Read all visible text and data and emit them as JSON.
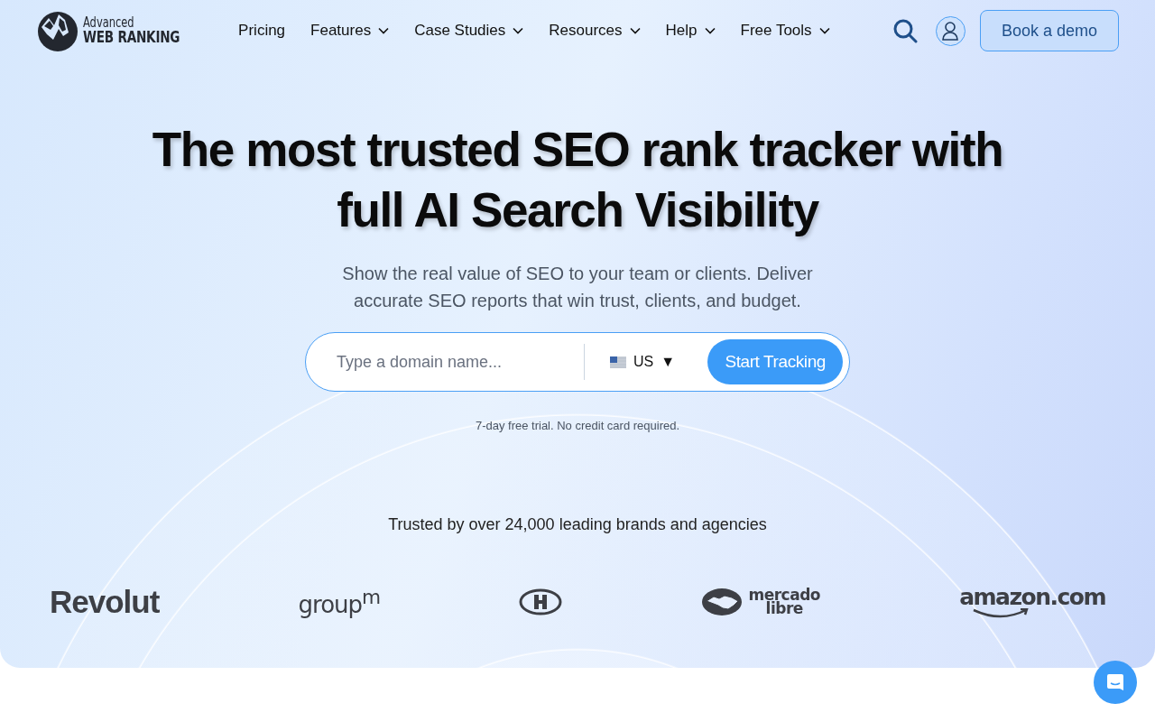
{
  "header": {
    "logo": {
      "line_1": "Advanced",
      "line_2": "WEB RANKING"
    },
    "nav": [
      {
        "label": "Pricing",
        "has_menu": false
      },
      {
        "label": "Features",
        "has_menu": true
      },
      {
        "label": "Case Studies",
        "has_menu": true
      },
      {
        "label": "Resources",
        "has_menu": true
      },
      {
        "label": "Help",
        "has_menu": true
      },
      {
        "label": "Free Tools",
        "has_menu": true
      }
    ],
    "cta": "Book a demo"
  },
  "hero": {
    "headline": "The most trusted SEO rank tracker with full AI Search Visibility",
    "subtitle": "Show the real value of SEO to your team or clients. Deliver accurate SEO reports that win trust, clients, and budget.",
    "domain_field": {
      "placeholder": "Type a domain name..."
    },
    "country": {
      "code": "US",
      "caret": "▼"
    },
    "submit": "Start Tracking",
    "note": "7-day free trial. No credit card required."
  },
  "trust": {
    "heading": "Trusted by over 24,000 leading brands and agencies",
    "logos": [
      {
        "kind": "revolut",
        "text": "Revolut"
      },
      {
        "kind": "groupm",
        "text": "group$^{m}$"
      },
      {
        "kind": "emblem"
      },
      {
        "kind": "mercado",
        "lines": [
          "mercado",
          "libre"
        ]
      },
      {
        "kind": "amazon",
        "text": "amazon.com"
      }
    ]
  }
}
